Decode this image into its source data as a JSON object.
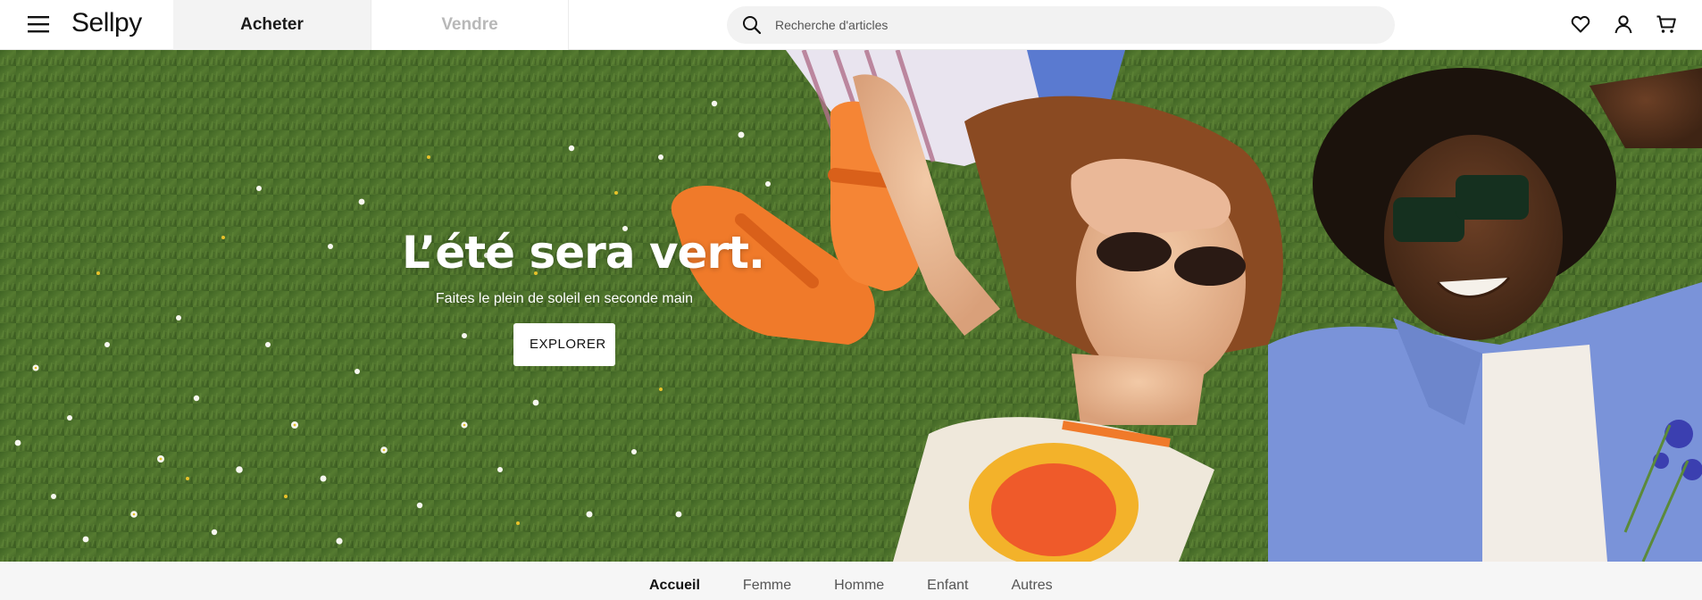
{
  "header": {
    "logo": "Sellpy",
    "tabs": [
      {
        "label": "Acheter",
        "active": true
      },
      {
        "label": "Vendre",
        "active": false
      }
    ],
    "search": {
      "placeholder": "Recherche d'articles",
      "value": ""
    },
    "icons": [
      "menu-icon",
      "search-icon",
      "heart-icon",
      "user-icon",
      "cart-icon"
    ]
  },
  "hero": {
    "title": "L’été sera vert.",
    "subtitle": "Faites le plein de soleil en seconde main",
    "cta": "EXPLORER"
  },
  "category_nav": {
    "items": [
      {
        "label": "Accueil",
        "active": true
      },
      {
        "label": "Femme",
        "active": false
      },
      {
        "label": "Homme",
        "active": false
      },
      {
        "label": "Enfant",
        "active": false
      },
      {
        "label": "Autres",
        "active": false
      }
    ]
  },
  "colors": {
    "grass": "#4a6e2a",
    "sandal_orange": "#f07a2a",
    "shirt_blue": "#7a93d9",
    "search_bg": "#f2f2f2"
  }
}
